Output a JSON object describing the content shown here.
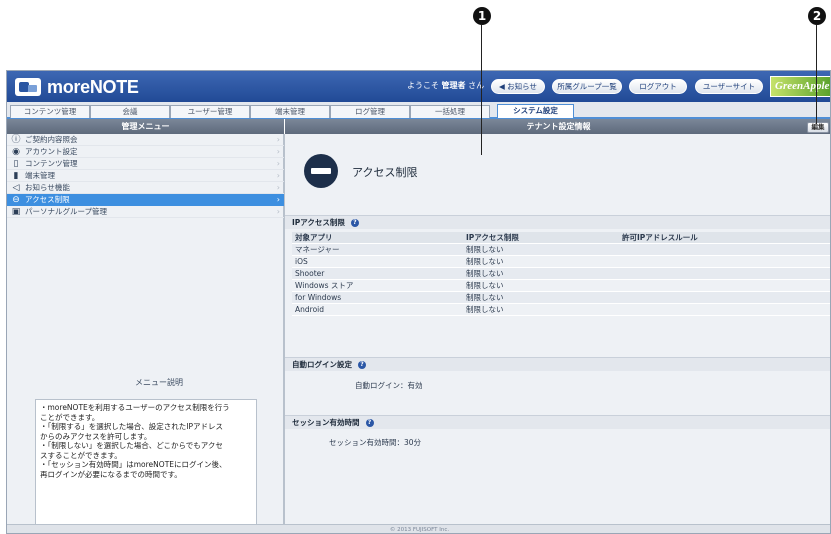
{
  "callouts": [
    "1",
    "2"
  ],
  "header": {
    "app_name": "moreNOTE",
    "welcome_prefix": "ようこそ ",
    "user_name": "管理者",
    "welcome_suffix": " さん",
    "buttons": [
      "お知らせ",
      "所属グループ一覧",
      "ログアウト",
      "ユーザーサイト"
    ],
    "partner_logo": "GreenApple"
  },
  "tabs": [
    "コンテンツ管理",
    "会議",
    "ユーザー管理",
    "端末管理",
    "ログ管理",
    "一括処理",
    "システム設定"
  ],
  "sidebar": {
    "title": "管理メニュー",
    "items": [
      {
        "label": "ご契約内容照会"
      },
      {
        "label": "アカウント設定"
      },
      {
        "label": "コンテンツ管理"
      },
      {
        "label": "端末管理"
      },
      {
        "label": "お知らせ機能"
      },
      {
        "label": "アクセス制限"
      },
      {
        "label": "パーソナルグループ管理"
      }
    ],
    "description_title": "メニュー説明",
    "description_lines": [
      "・moreNOTEを利用するユーザーのアクセス制限を行う",
      "ことができます。",
      "・「制限する」を選択した場合、設定されたIPアドレス",
      "からのみアクセスを許可します。",
      "・「制限しない」を選択した場合、どこからでもアクセ",
      "スすることができます。",
      "・「セッション有効時間」はmoreNOTEにログイン後、",
      "再ログインが必要になるまでの時間です。"
    ]
  },
  "main": {
    "bar_title": "テナント設定情報",
    "edit_label": "編集",
    "page_title": "アクセス制限",
    "ip_section": {
      "title": "IPアクセス制限",
      "columns": [
        "対象アプリ",
        "IPアクセス制限",
        "許可IPアドレスルール"
      ],
      "rows": [
        [
          "マネージャー",
          "制限しない",
          ""
        ],
        [
          "iOS",
          "制限しない",
          ""
        ],
        [
          "Shooter",
          "制限しない",
          ""
        ],
        [
          "Windows ストア",
          "制限しない",
          ""
        ],
        [
          "for Windows",
          "制限しない",
          ""
        ],
        [
          "Android",
          "制限しない",
          ""
        ]
      ]
    },
    "auto_login": {
      "title": "自動ログイン設定",
      "value": "自動ログイン：有効"
    },
    "session": {
      "title": "セッション有効時間",
      "value": "セッション有効時間：30分"
    }
  },
  "footer": "© 2013 FUJISOFT Inc."
}
